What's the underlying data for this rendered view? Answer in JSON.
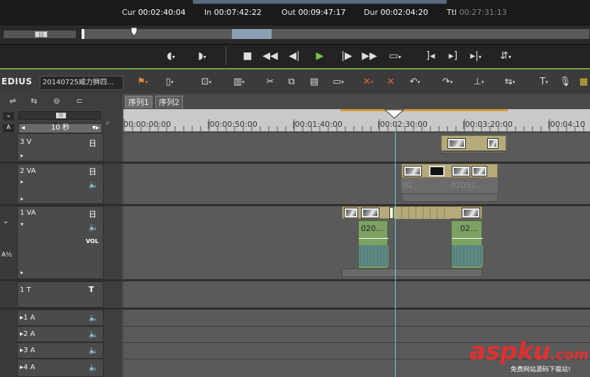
{
  "timecodes": {
    "cur_label": "Cur",
    "cur_value": "00:02:40:04",
    "in_label": "In",
    "in_value": "00:07:42:22",
    "out_label": "Out",
    "out_value": "00:09:47:17",
    "dur_label": "Dur",
    "dur_value": "00:02:04:20",
    "ttl_label": "Ttl",
    "ttl_value": "00:27:31:13"
  },
  "toolbar": {
    "logo": "EDIUS",
    "project_name": "20140725威力狮四..."
  },
  "tabs": [
    "序列1",
    "序列2"
  ],
  "scale": "10 秒",
  "ruler_labels": [
    "00:00:00:00",
    "|00:00:50:00",
    "|00:01:40:00",
    "|00:02:30:00",
    "|00:03:20:00",
    "|00:04:10"
  ],
  "tracks": {
    "v3": {
      "name": "3 V"
    },
    "va2": {
      "name": "2 VA",
      "clip_text1": "02...",
      "clip_text2": "02052..."
    },
    "va1": {
      "name": "1 VA",
      "vol": "VOL",
      "clip_text1": "020...",
      "clip_text2": "02..."
    },
    "t1": {
      "name": "1 T"
    },
    "a1": {
      "name": "1 A"
    },
    "a2": {
      "name": "2 A"
    },
    "a3": {
      "name": "3 A"
    },
    "a4": {
      "name": "4 A"
    }
  },
  "watermark": {
    "main": "aspku",
    "tld": ".com",
    "sub": "免费网站源码下载站!"
  },
  "colors": {
    "accent_green": "#7ec24a",
    "cursor": "#5fd4d4",
    "inout": "#d49a3a"
  }
}
